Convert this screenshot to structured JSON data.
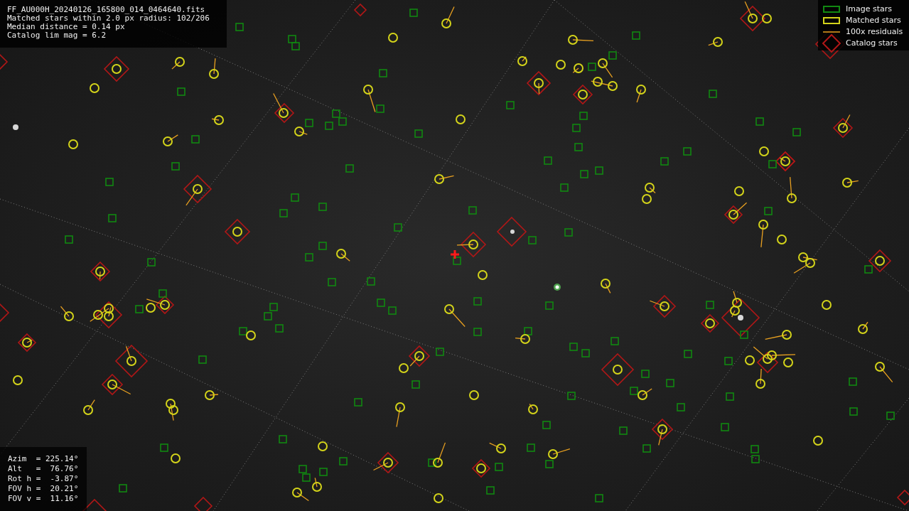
{
  "file_info": {
    "lines": [
      "FF_AU000H_20240126_165800_014_0464640.fits",
      "Matched stars within 2.0 px radius: 102/206",
      "Median distance = 0.14 px",
      "Catalog lim mag = 6.2"
    ]
  },
  "legend": [
    {
      "kind": "image",
      "label": "Image stars"
    },
    {
      "kind": "matched",
      "label": "Matched stars"
    },
    {
      "kind": "residual",
      "label": "100x residuals"
    },
    {
      "kind": "catalog",
      "label": "Catalog stars"
    }
  ],
  "pointing": {
    "lines": [
      "Azim  = 225.14°",
      "Alt   =  76.76°",
      "Rot h =  -3.87°",
      "FOV h =  20.21°",
      "FOV v =  11.16°"
    ]
  }
}
